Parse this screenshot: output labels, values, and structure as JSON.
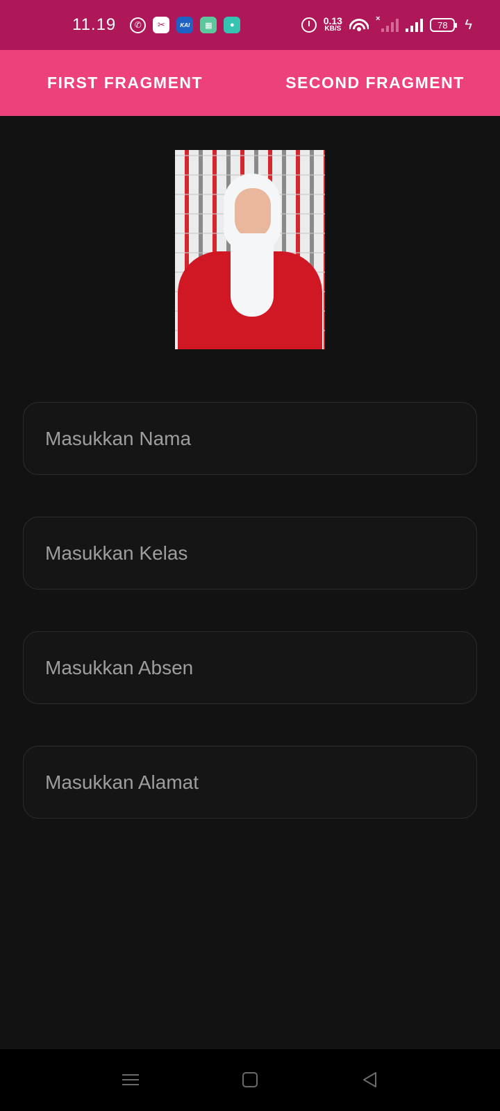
{
  "status_bar": {
    "time": "11.19",
    "notification_icons": [
      "whatsapp-icon",
      "capcut-icon",
      "kai-access-icon",
      "calendar-app-icon",
      "chat-app-icon"
    ],
    "net_speed_value": "0.13",
    "net_speed_unit": "KB/S",
    "battery_level": "78",
    "colors": {
      "background": "#AE1758"
    }
  },
  "tabs": [
    {
      "label": "FIRST FRAGMENT"
    },
    {
      "label": "SECOND FRAGMENT"
    }
  ],
  "tab_bar_color": "#EC417A",
  "form": {
    "fields": [
      {
        "placeholder": "Masukkan Nama"
      },
      {
        "placeholder": "Masukkan Kelas"
      },
      {
        "placeholder": "Masukkan Absen"
      },
      {
        "placeholder": "Masukkan Alamat"
      }
    ]
  },
  "nav_bar": {
    "buttons": [
      "menu-icon",
      "home-icon",
      "back-icon"
    ]
  }
}
